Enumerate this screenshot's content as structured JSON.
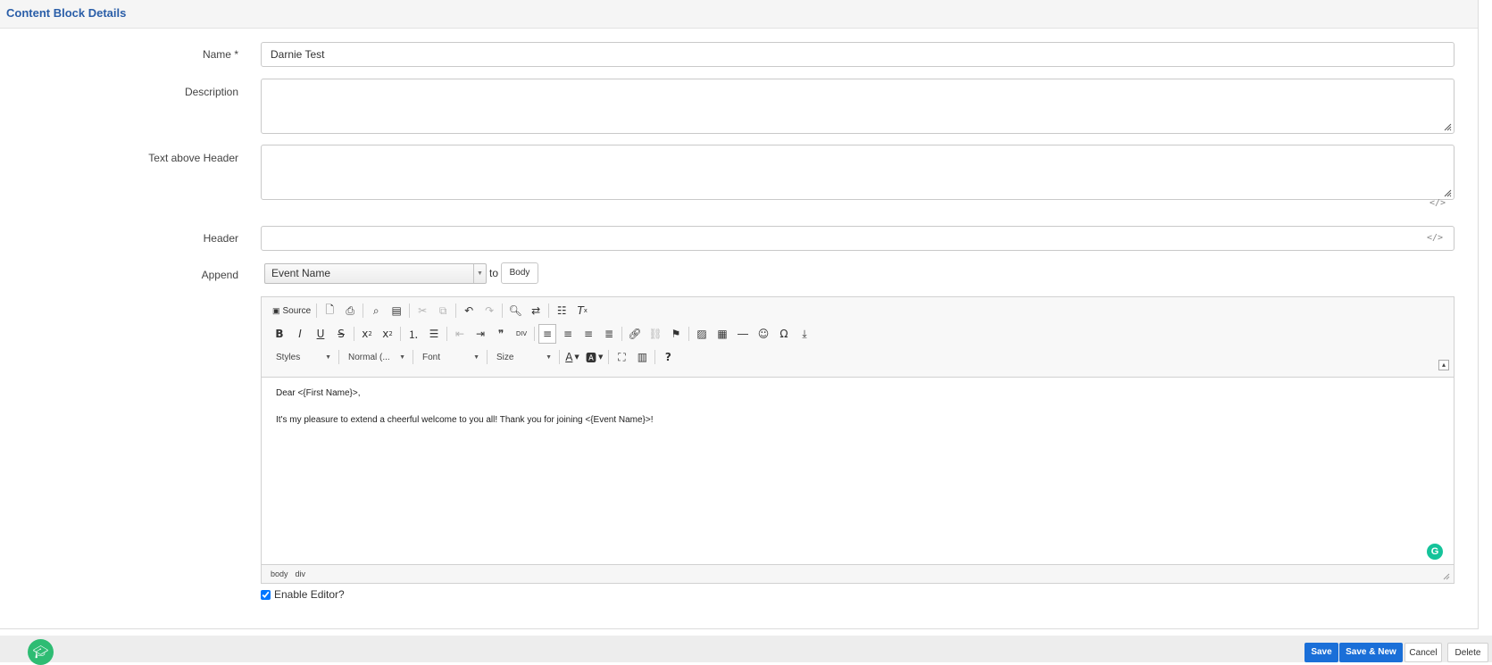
{
  "page": {
    "title": "Content Block Details"
  },
  "form": {
    "name": {
      "label": "Name",
      "required_mark": "*",
      "value": "Darnie Test"
    },
    "description": {
      "label": "Description",
      "value": ""
    },
    "text_above_header": {
      "label": "Text above Header",
      "value": ""
    },
    "header": {
      "label": "Header",
      "value": ""
    },
    "append": {
      "label": "Append",
      "selected": "Event Name",
      "to_text": "to",
      "target_button": "Body"
    }
  },
  "editor": {
    "toolbar": {
      "source_label": "Source",
      "styles_label": "Styles",
      "format_label": "Normal (...",
      "font_label": "Font",
      "size_label": "Size"
    },
    "content": {
      "line1": "Dear <{First Name}>,",
      "line2": "It's my pleasure to extend a cheerful welcome to you all! Thank you for joining <{Event Name}>!"
    },
    "statusbar": {
      "path": [
        "body",
        "div"
      ]
    }
  },
  "enable_editor": {
    "label": "Enable Editor?",
    "checked": true
  },
  "footer": {
    "save": "Save",
    "save_new": "Save & New",
    "cancel": "Cancel",
    "delete": "Delete"
  },
  "colors": {
    "primary_button": "#1a6fd8",
    "title": "#2a5ea8",
    "help_bubble": "#2ebc73",
    "grammarly": "#15c39a"
  }
}
